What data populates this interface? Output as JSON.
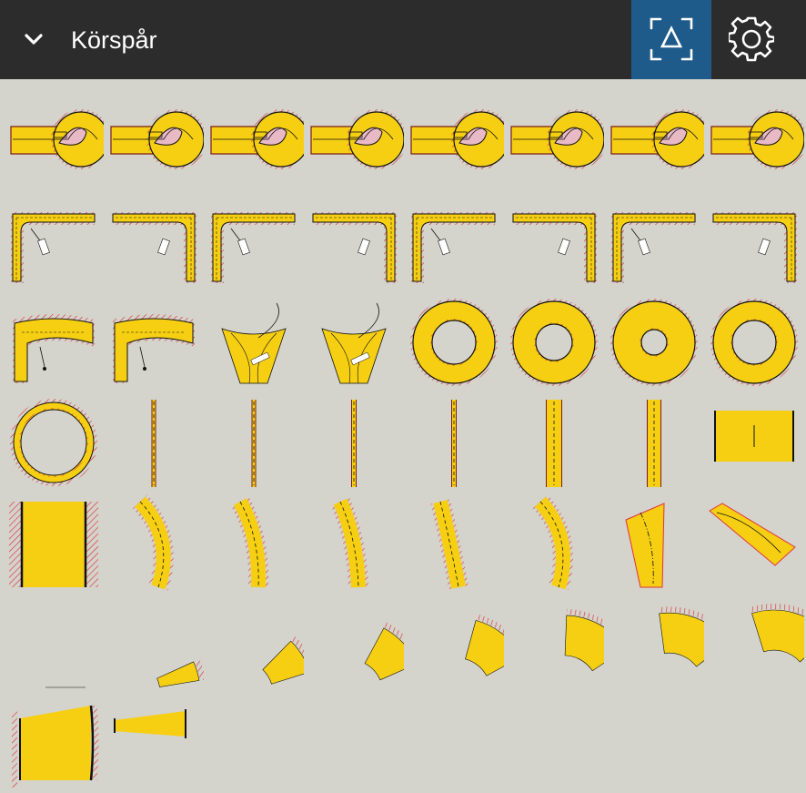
{
  "header": {
    "title": "Körspår",
    "collapse_icon": "chevron-down-icon",
    "fit_button_icon": "fit-view-triangle-icon",
    "settings_button_icon": "gear-icon",
    "accent_color": "#1f5b8a"
  },
  "palette": {
    "road": "#f6cf13",
    "edge": "#7a1c1c",
    "hatch": "#e0323a",
    "line": "#111111"
  },
  "library": {
    "rows": [
      {
        "kind": "roundabout-turn",
        "count": 8
      },
      {
        "kind": "l-junction-turn",
        "count": 8
      },
      {
        "kind": "s-curve / merge / ring",
        "count": 8
      },
      {
        "kind": "ring / straight / lane",
        "count": 8
      },
      {
        "kind": "lane / bend",
        "count": 8
      },
      {
        "kind": "curve-segment",
        "count": 8
      },
      {
        "kind": "taper-segment",
        "count": 2
      }
    ]
  }
}
